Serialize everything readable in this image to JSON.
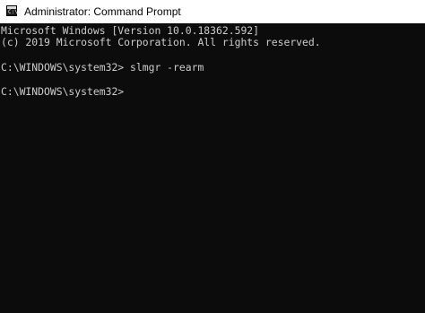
{
  "window": {
    "title": "Administrator: Command Prompt",
    "icon": "command-prompt-icon",
    "icon_glyph": "C:\\"
  },
  "console": {
    "lines": [
      "Microsoft Windows [Version 10.0.18362.592]",
      "(c) 2019 Microsoft Corporation. All rights reserved.",
      "",
      "C:\\WINDOWS\\system32> slmgr -rearm",
      "",
      "C:\\WINDOWS\\system32>"
    ]
  },
  "colors": {
    "console_background": "#0c0c0c",
    "console_text": "#cccccc",
    "titlebar_background": "#ffffff",
    "titlebar_text": "#000000"
  }
}
